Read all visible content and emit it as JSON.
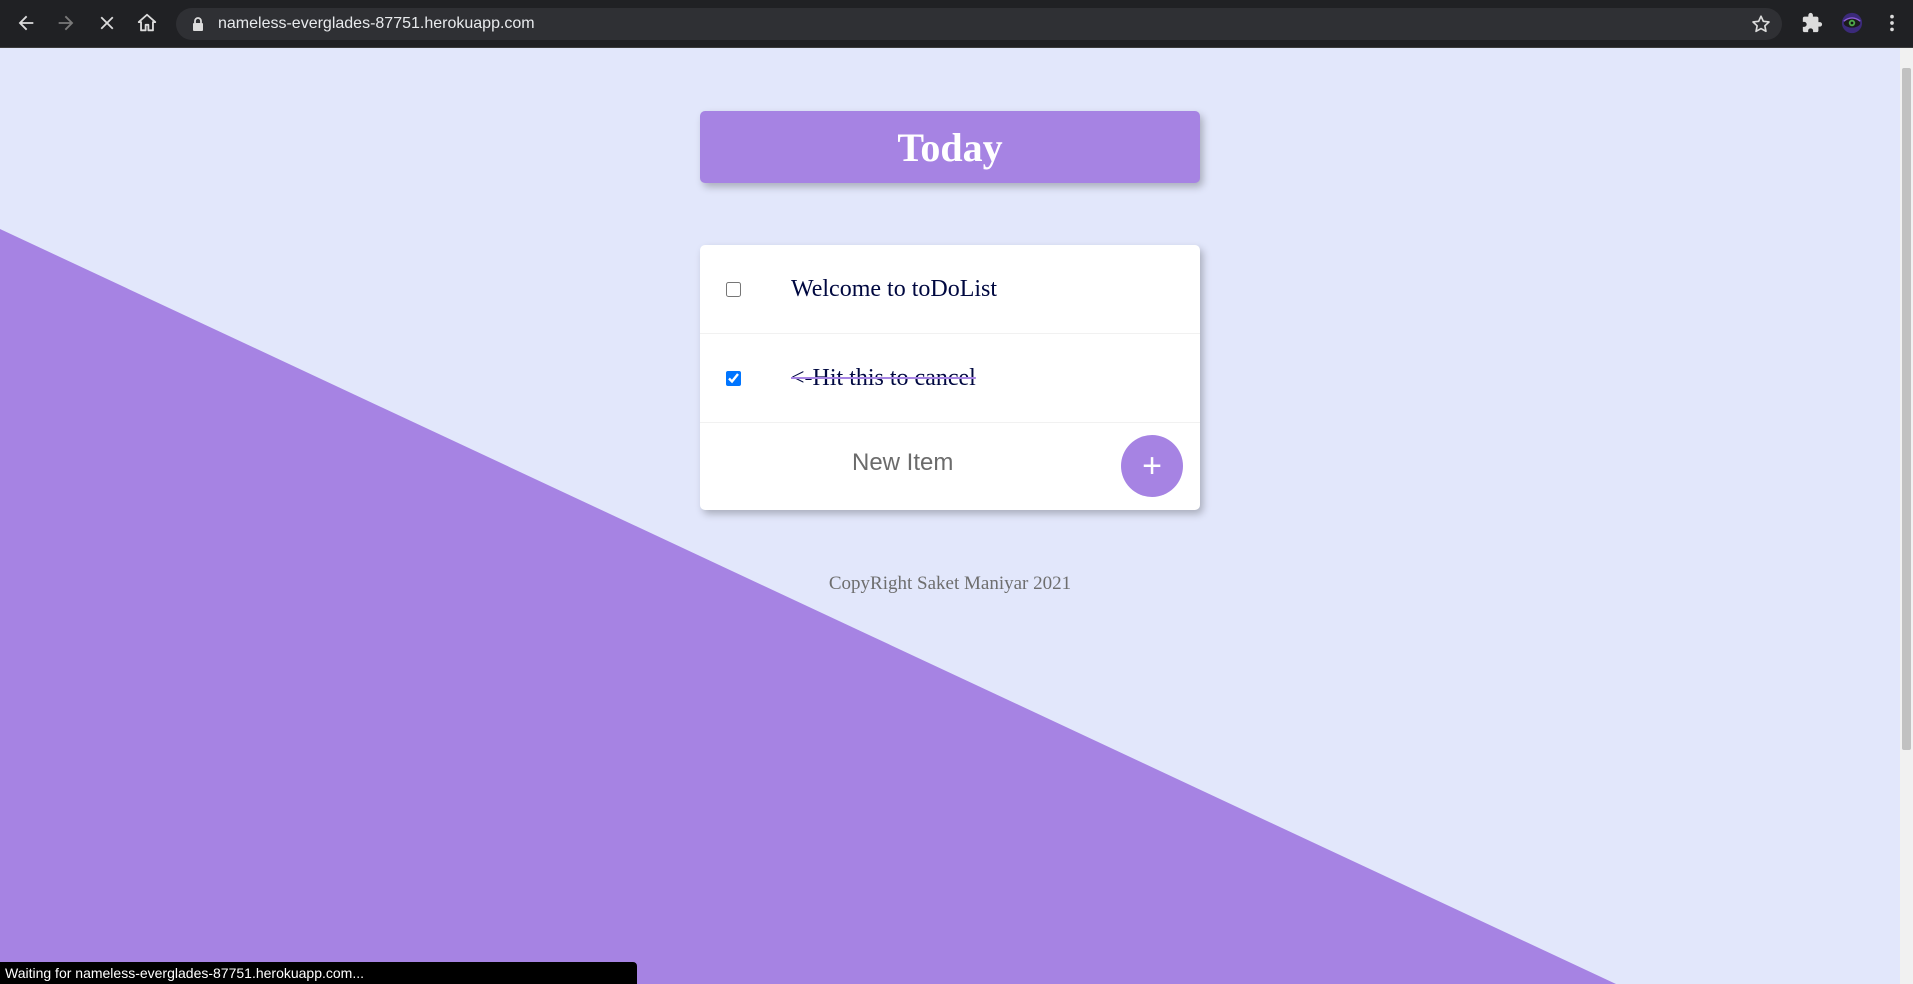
{
  "browser": {
    "url": "nameless-everglades-87751.herokuapp.com",
    "status_text": "Waiting for nameless-everglades-87751.herokuapp.com...",
    "icons": [
      "back-icon",
      "forward-icon",
      "stop-icon",
      "home-icon",
      "lock-icon",
      "star-icon",
      "extensions-icon",
      "profile-avatar",
      "menu-icon"
    ]
  },
  "list": {
    "heading": "Today",
    "items": [
      {
        "text": "Welcome to toDoList",
        "checked": false
      },
      {
        "text": "<-Hit this to cancel",
        "checked": true
      }
    ],
    "new_item_placeholder": "New Item",
    "add_button_label": "+"
  },
  "footer": {
    "text": "CopyRight Saket Maniyar 2021"
  },
  "colors": {
    "accent": "#a683e3",
    "background": "#e2e7fb",
    "item_text": "#000840"
  }
}
